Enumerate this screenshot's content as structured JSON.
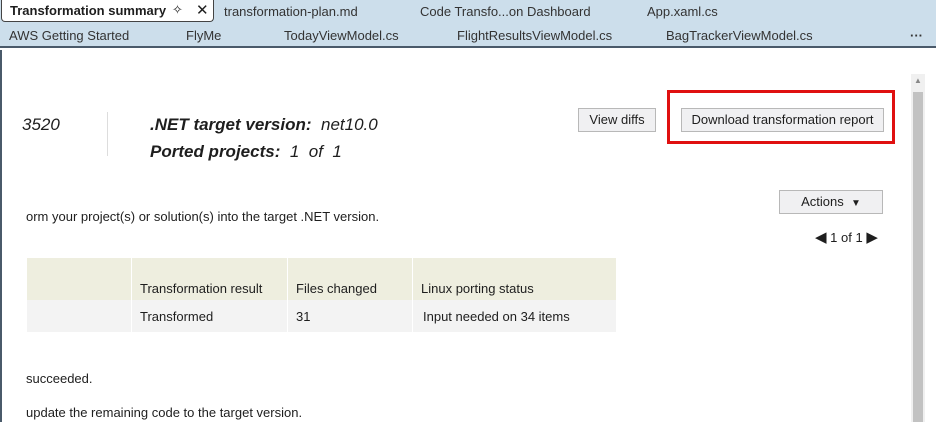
{
  "tabs_row1": {
    "active": "Transformation summary",
    "items": [
      "transformation-plan.md",
      "Code Transfo...on Dashboard",
      "App.xaml.cs"
    ]
  },
  "tabs_row2": {
    "items": [
      "AWS Getting Started",
      "FlyMe",
      "TodayViewModel.cs",
      "FlightResultsViewModel.cs",
      "BagTrackerViewModel.cs"
    ],
    "overflow": "···"
  },
  "summary": {
    "id_fragment": "3520",
    "target_label": ".NET target version:",
    "target_value": "net10.0",
    "ported_label": "Ported projects:",
    "ported_value": "1",
    "ported_of": "of",
    "ported_total": "1"
  },
  "buttons": {
    "view_diffs": "View diffs",
    "download": "Download transformation report",
    "actions": "Actions"
  },
  "description": "orm your project(s) or solution(s) into the target .NET version.",
  "pager": {
    "current": "1",
    "of": "of",
    "total": "1"
  },
  "table": {
    "headers": [
      "",
      "Transformation result",
      "Files changed",
      "Linux porting status"
    ],
    "rows": [
      [
        "",
        "Transformed",
        "31",
        "Input needed on 34 items"
      ]
    ]
  },
  "notes": [
    "succeeded.",
    "update the remaining code to the target version."
  ]
}
